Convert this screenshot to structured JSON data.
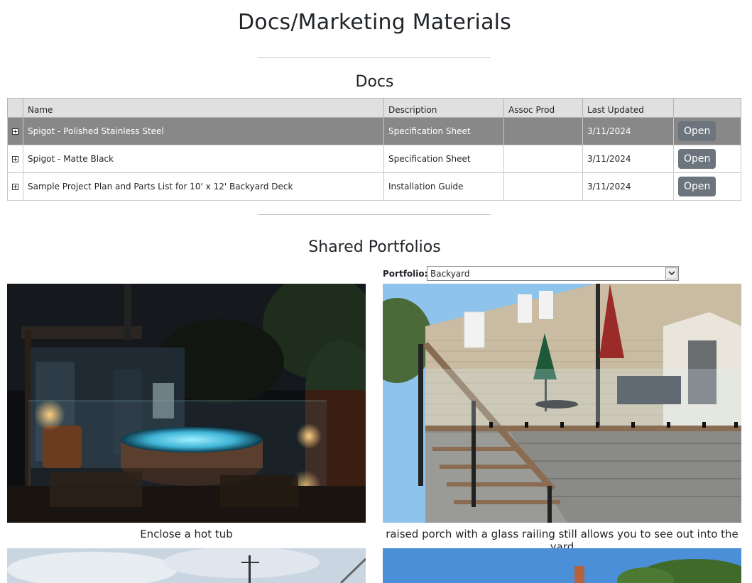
{
  "page": {
    "title": "Docs/Marketing Materials"
  },
  "docs": {
    "title": "Docs",
    "columns": [
      "",
      "Name",
      "Description",
      "Assoc Prod",
      "Last Updated",
      ""
    ],
    "rows": [
      {
        "name": "Spigot - Polished Stainless Steel",
        "description": "Specification Sheet",
        "assoc_prod": "",
        "last_updated": "3/11/2024",
        "action": "Open",
        "selected": true
      },
      {
        "name": "Spigot - Matte Black",
        "description": "Specification Sheet",
        "assoc_prod": "",
        "last_updated": "3/11/2024",
        "action": "Open",
        "selected": false
      },
      {
        "name": "Sample Project Plan and Parts List for 10' x 12' Backyard Deck",
        "description": "Installation Guide",
        "assoc_prod": "",
        "last_updated": "3/11/2024",
        "action": "Open",
        "selected": false
      }
    ]
  },
  "portfolios": {
    "title": "Shared Portfolios",
    "label": "Portfolio:",
    "selected": "Backyard",
    "items": [
      {
        "caption": "Enclose a hot tub"
      },
      {
        "caption": "raised porch with a glass railing still allows you to see out into the yard"
      }
    ]
  },
  "colors": {
    "selected_row": "#888888",
    "header_bg": "#e0e0e0",
    "button": "#6c757d"
  }
}
